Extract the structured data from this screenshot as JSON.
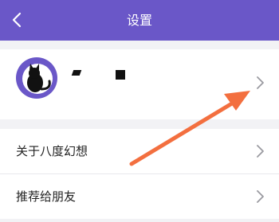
{
  "header": {
    "title": "设置"
  },
  "menu": {
    "items": [
      {
        "label": "关于八度幻想"
      },
      {
        "label": "推荐给朋友"
      }
    ]
  },
  "colors": {
    "header_bg": "#6a57c8",
    "annotation_arrow": "#f36f3f"
  }
}
